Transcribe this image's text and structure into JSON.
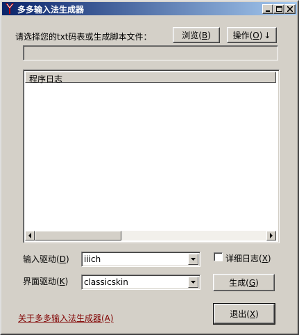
{
  "window": {
    "title": "多多输入法生成器",
    "caption_buttons": [
      "minimize",
      "maximize",
      "close"
    ]
  },
  "file_prompt": {
    "label": "请选择您的txt码表或生成脚本文件：",
    "path_value": ""
  },
  "buttons": {
    "browse": {
      "text": "浏览(",
      "hotkey": "B",
      "tail": ")"
    },
    "operate": {
      "text": "操作(",
      "hotkey": "O",
      "tail": ")",
      "arrow": "↓"
    },
    "generate": {
      "text": "生成(",
      "hotkey": "G",
      "tail": ")"
    },
    "exit": {
      "text": "退出(",
      "hotkey": "X",
      "tail": ")"
    }
  },
  "log": {
    "column_header": "程序日志",
    "lines": []
  },
  "input_driver": {
    "text": "输入驱动(",
    "hotkey": "D",
    "tail": ")",
    "value": "iiich"
  },
  "ui_driver": {
    "text": "界面驱动(",
    "hotkey": "K",
    "tail": ")",
    "value": "classicskin"
  },
  "verbose_log": {
    "text": "详细日志(",
    "hotkey": "X",
    "tail": ")",
    "checked": false
  },
  "about_link": {
    "label": "关于多多输入法生成器(A)",
    "color": "#800000"
  },
  "colors": {
    "titlebar_start": "#0a246a",
    "titlebar_end": "#a6caf0",
    "face": "#d4d0c8"
  }
}
